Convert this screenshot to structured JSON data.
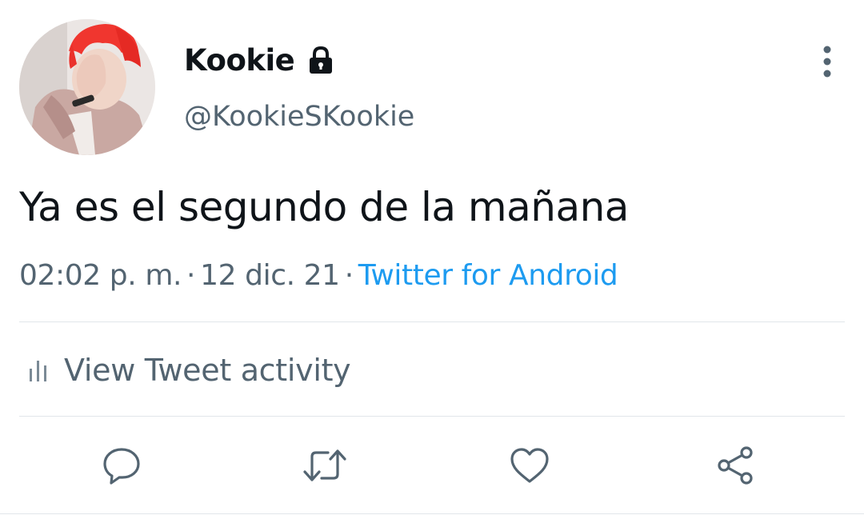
{
  "tweet": {
    "author": {
      "display_name": "Kookie",
      "handle": "@KookieSKookie",
      "avatar": "avatar-photo",
      "protected_icon": "lock-icon"
    },
    "menu_icon": "more-vertical-icon",
    "text": "Ya es el segundo de la mañana",
    "time": "02:02 p. m.",
    "separator": "·",
    "date": "12 dic. 21",
    "source": "Twitter for Android"
  },
  "activity": {
    "icon": "activity-bars-icon",
    "label": "View Tweet activity"
  },
  "actions": [
    {
      "name": "reply",
      "icon": "reply-icon"
    },
    {
      "name": "retweet",
      "icon": "retweet-icon"
    },
    {
      "name": "like",
      "icon": "heart-icon"
    },
    {
      "name": "share",
      "icon": "share-icon"
    }
  ],
  "colors": {
    "text_primary": "#0f1419",
    "text_secondary": "#536471",
    "accent": "#1d9bf0",
    "divider": "#e1e6ea",
    "background": "#ffffff"
  }
}
